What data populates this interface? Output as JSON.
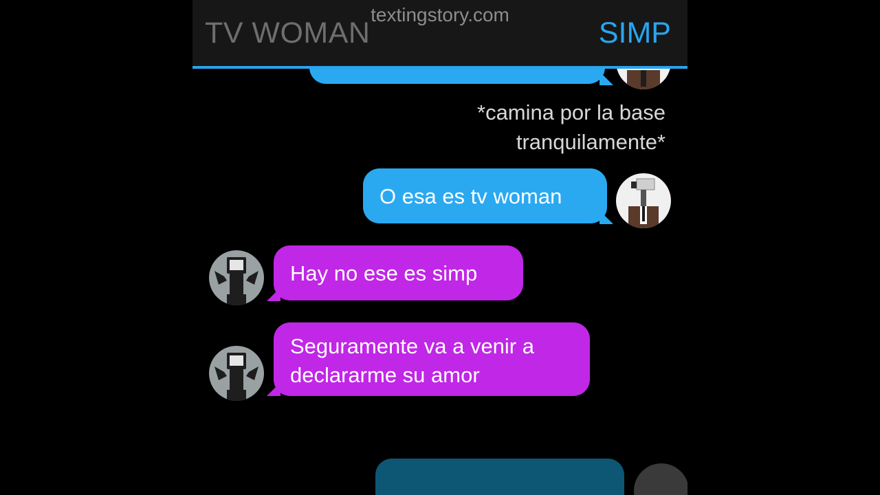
{
  "header": {
    "contact_left": "TV WOMAN",
    "contact_right": "SIMP",
    "watermark": "textingstory.com"
  },
  "narration": {
    "line1": "*camina por la base",
    "line2": "tranquilamente*"
  },
  "messages": [
    {
      "sender": "SIMP",
      "side": "right",
      "text": "O esa es tv woman"
    },
    {
      "sender": "TV WOMAN",
      "side": "left",
      "text": "Hay no ese es simp"
    },
    {
      "sender": "TV WOMAN",
      "side": "left",
      "line1": "Seguramente va a venir a",
      "line2": "declararme su amor"
    }
  ],
  "colors": {
    "simp_bubble": "#2aa9f1",
    "tv_woman_bubble": "#c027e6",
    "header_background": "#171717",
    "accent_line": "#2aa3ec",
    "background": "#000000"
  },
  "icons": {
    "simp_avatar": "security-camera-head-suit-avatar-icon",
    "tv_woman_avatar": "tv-head-figure-avatar-icon"
  }
}
